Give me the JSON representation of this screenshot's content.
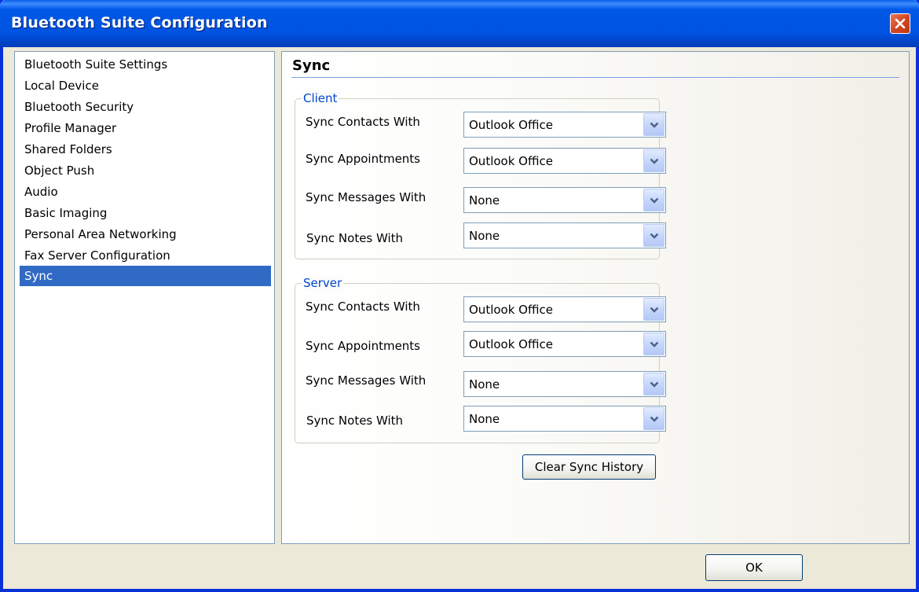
{
  "window": {
    "title": "Bluetooth Suite Configuration"
  },
  "sidebar": {
    "items": [
      {
        "label": "Bluetooth Suite Settings"
      },
      {
        "label": "Local Device"
      },
      {
        "label": "Bluetooth Security"
      },
      {
        "label": "Profile Manager"
      },
      {
        "label": "Shared Folders"
      },
      {
        "label": "Object Push"
      },
      {
        "label": "Audio"
      },
      {
        "label": "Basic Imaging"
      },
      {
        "label": "Personal Area Networking"
      },
      {
        "label": "Fax Server Configuration"
      },
      {
        "label": "Sync",
        "selected": true
      }
    ]
  },
  "panel": {
    "title": "Sync",
    "client": {
      "label": "Client",
      "fields": [
        {
          "label": "Sync Contacts With",
          "value": "Outlook Office"
        },
        {
          "label": "Sync Appointments",
          "value": "Outlook Office"
        },
        {
          "label": "Sync Messages With",
          "value": "None"
        },
        {
          "label": "Sync Notes With",
          "value": "None"
        }
      ]
    },
    "server": {
      "label": "Server",
      "fields": [
        {
          "label": "Sync Contacts With",
          "value": "Outlook Office"
        },
        {
          "label": "Sync Appointments",
          "value": "Outlook Office"
        },
        {
          "label": "Sync Messages With",
          "value": "None"
        },
        {
          "label": "Sync Notes With",
          "value": "None"
        }
      ]
    },
    "clear_button": "Clear Sync History"
  },
  "footer": {
    "ok_label": "OK"
  },
  "icons": {
    "close": "close-icon",
    "dropdown": "chevron-down-icon"
  },
  "colors": {
    "titlebar": "#0054E3",
    "selection": "#316AC5",
    "group_label": "#0046D5"
  }
}
